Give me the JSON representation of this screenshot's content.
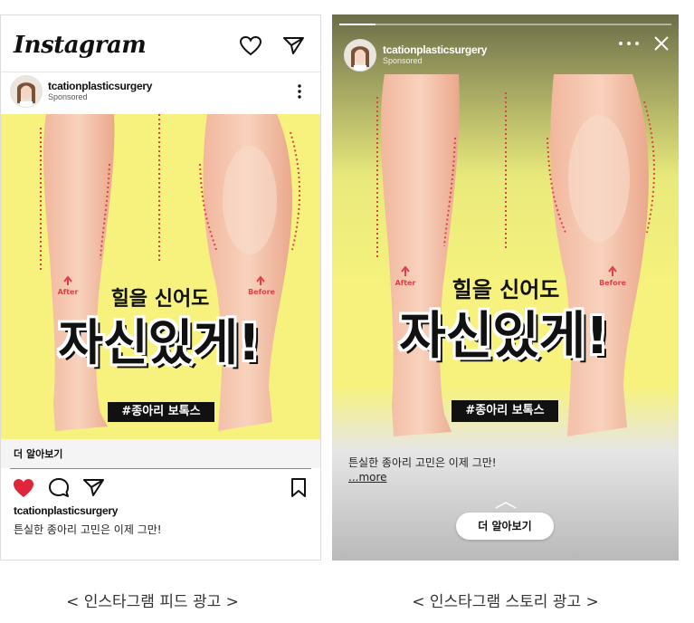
{
  "feed": {
    "logo": "Instagram",
    "account": "tcationplasticsurgery",
    "sponsored": "Sponsored",
    "cta": "더 알아보기",
    "caption_account": "tcationplasticsurgery",
    "caption_text": "튼실한 종아리 고민은 이제 그만!"
  },
  "story": {
    "account": "tcationplasticsurgery",
    "sponsored": "Sponsored",
    "caption": "튼실한 종아리 고민은 이제 그만!",
    "more": "...more",
    "cta": "더 알아보기"
  },
  "creative": {
    "headline_small": "힐을 신어도",
    "headline_big": "자신있게!",
    "hashtag": "#종아리 보톡스",
    "after_label": "After",
    "before_label": "Before"
  },
  "labels": {
    "feed_caption": "< 인스타그램 피드 광고 >",
    "story_caption": "< 인스타그램 스토리 광고 >"
  },
  "colors": {
    "creative_bg": "#f6f27d",
    "heart": "#e0253a",
    "arrow": "#e0404a"
  }
}
